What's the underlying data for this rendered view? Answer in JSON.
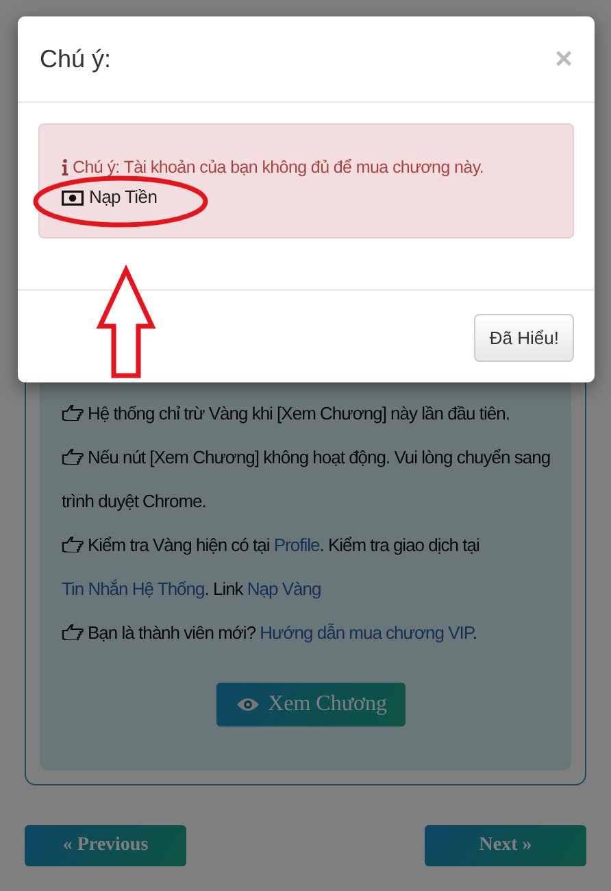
{
  "modal": {
    "title": "Chú ý:",
    "close": "×",
    "alert": {
      "message": "Chú ý: Tài khoản của bạn không đủ để mua chương này.",
      "link": "Nạp Tiền"
    },
    "button": "Đã Hiểu!"
  },
  "notes": [
    {
      "parts": [
        {
          "kind": "text",
          "text": "Hệ thống chỉ trừ Vàng khi [Xem Chương] này lần đầu tiên."
        }
      ]
    },
    {
      "parts": [
        {
          "kind": "text",
          "text": "Nếu nút [Xem Chương] không hoạt động. Vui lòng chuyển sang trình duyệt Chrome."
        }
      ]
    },
    {
      "parts": [
        {
          "kind": "text",
          "text": "Kiểm tra Vàng hiện có tại "
        },
        {
          "kind": "link",
          "text": "Profile"
        },
        {
          "kind": "text",
          "text": ". Kiểm tra giao dịch tại "
        },
        {
          "kind": "link",
          "text": "Tin Nhắn Hệ Thống"
        },
        {
          "kind": "text",
          "text": ". Link "
        },
        {
          "kind": "link",
          "text": "Nạp Vàng"
        }
      ]
    },
    {
      "parts": [
        {
          "kind": "text",
          "text": "Bạn là thành viên mới? "
        },
        {
          "kind": "link",
          "text": "Hướng dẫn mua chương VIP"
        },
        {
          "kind": "text",
          "text": "."
        }
      ]
    }
  ],
  "view_button": "Xem Chương",
  "nav": {
    "previous": "« Previous",
    "next": "Next »"
  }
}
